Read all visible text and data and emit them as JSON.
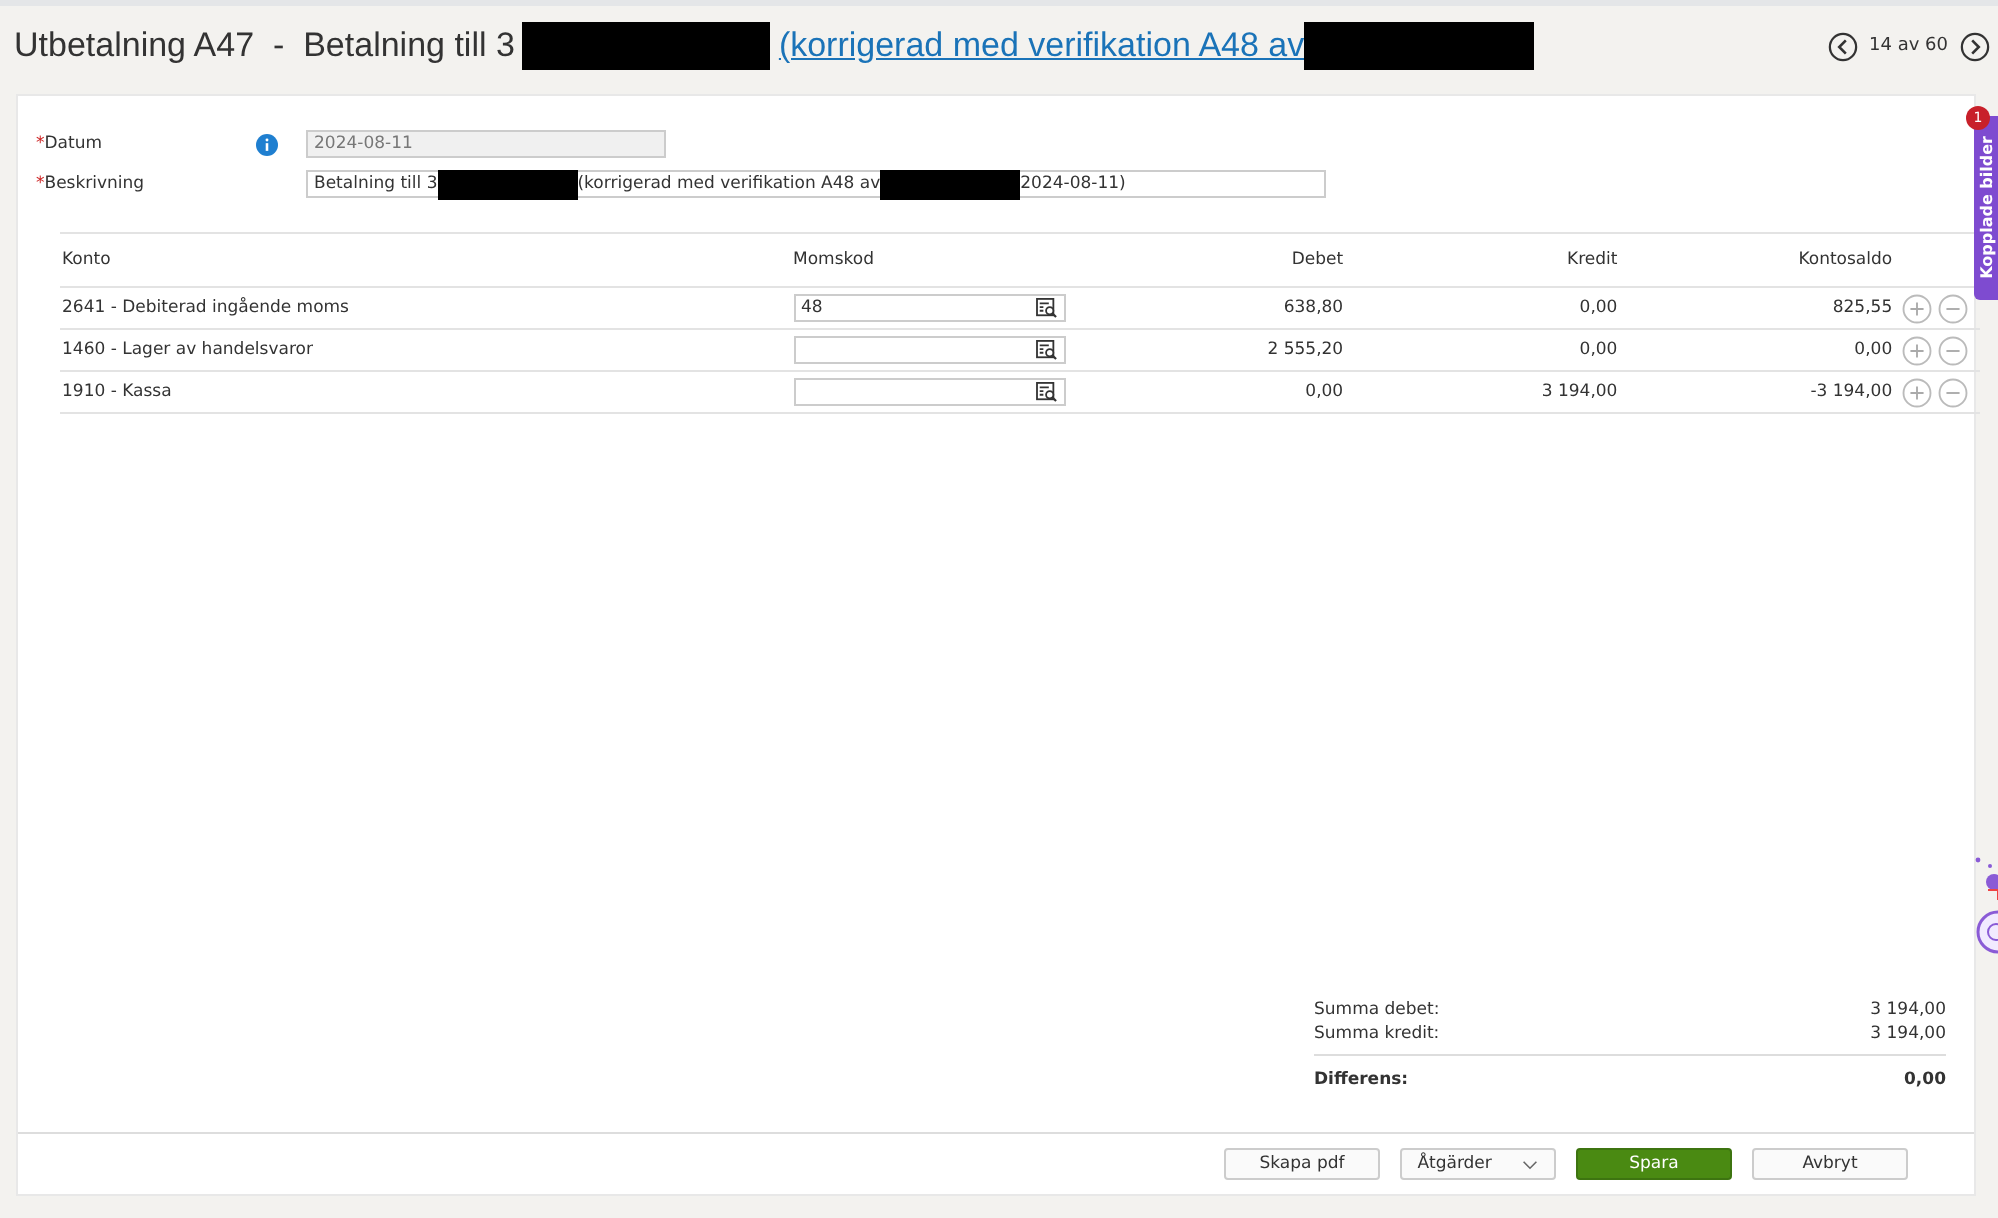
{
  "header": {
    "title": "Utbetalning A47  -  Betalning till 3",
    "link": "(korrigerad med verifikation A48 av",
    "pager": "14 av 60"
  },
  "form": {
    "date": {
      "label": "Datum",
      "required_mark": "*",
      "value": "2024-08-11",
      "disabled": true
    },
    "description": {
      "label": "Beskrivning",
      "required_mark": "*",
      "value_parts": [
        "Betalning till 3",
        "(korrigerad med verifikation A48 av",
        "2024-08-11)"
      ]
    }
  },
  "table": {
    "columns": [
      "Konto",
      "Momskod",
      "Debet",
      "Kredit",
      "Kontosaldo"
    ],
    "rows": [
      {
        "konto": "2641 - Debiterad ingående moms",
        "momskod": "48",
        "debet": "638,80",
        "kredit": "0,00",
        "kontosaldo": "825,55"
      },
      {
        "konto": "1460 - Lager av handelsvaror",
        "momskod": "",
        "debet": "2 555,20",
        "kredit": "0,00",
        "kontosaldo": "0,00"
      },
      {
        "konto": "1910 - Kassa",
        "momskod": "",
        "debet": "0,00",
        "kredit": "3 194,00",
        "kontosaldo": "-3 194,00"
      }
    ]
  },
  "totals": [
    {
      "label": "Summa debet:",
      "value": "3 194,00",
      "bold": false
    },
    {
      "label": "Summa kredit:",
      "value": "3 194,00",
      "bold": false
    },
    {
      "label": "Differens:",
      "value": "0,00",
      "bold": true
    }
  ],
  "side_tab": {
    "label": "Kopplade bilder",
    "badge": "1"
  },
  "buttons": [
    {
      "label": "Skapa pdf",
      "kind": "plain"
    },
    {
      "label": "Åtgärder",
      "kind": "dropdown"
    },
    {
      "label": "Spara",
      "kind": "primary"
    },
    {
      "label": "Avbryt",
      "kind": "plain"
    }
  ]
}
